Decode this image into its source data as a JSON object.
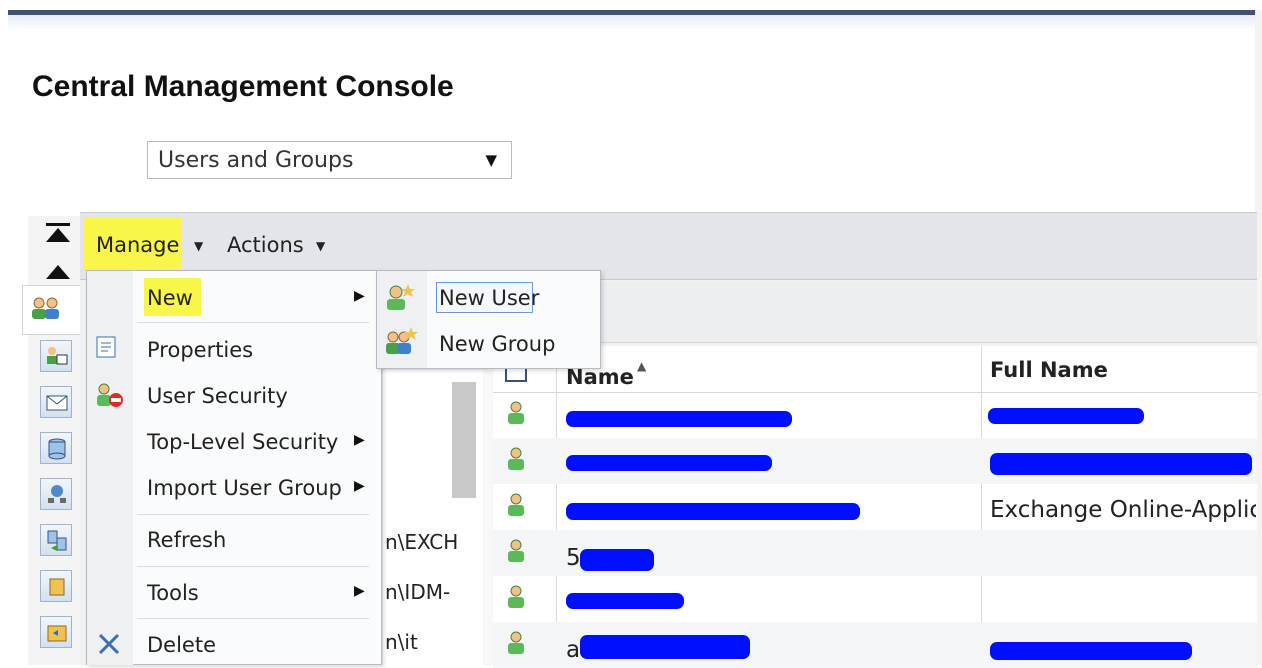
{
  "app": {
    "title": "Central Management Console"
  },
  "selector": {
    "value": "Users and Groups",
    "arrow": "▼"
  },
  "toolbar": {
    "manage": "Manage",
    "actions": "Actions"
  },
  "manage_menu": {
    "items": [
      {
        "label": "New",
        "icon": "",
        "submenu": true,
        "highlighted": true
      },
      {
        "label": "Properties",
        "icon": "properties-icon",
        "submenu": false
      },
      {
        "label": "User Security",
        "icon": "user-security-icon",
        "submenu": false
      },
      {
        "label": "Top-Level Security",
        "icon": "",
        "submenu": true
      },
      {
        "label": "Import User Group",
        "icon": "",
        "submenu": true
      },
      {
        "label": "Refresh",
        "icon": "",
        "submenu": false
      },
      {
        "label": "Tools",
        "icon": "",
        "submenu": true
      },
      {
        "label": "Delete",
        "icon": "delete-icon",
        "submenu": false
      }
    ]
  },
  "new_submenu": {
    "items": [
      {
        "label": "New User",
        "icon": "new-user-icon",
        "focused": true
      },
      {
        "label": "New Group",
        "icon": "new-group-icon"
      }
    ]
  },
  "tree_partial": [
    "n\\EXCH",
    "n\\IDM-",
    "n\\it"
  ],
  "table": {
    "columns": [
      {
        "label": "Name",
        "sort": "ascending"
      },
      {
        "label": "Full Name"
      }
    ],
    "rows": [
      {
        "name": "",
        "full_name": ""
      },
      {
        "name": "",
        "full_name": ""
      },
      {
        "name": "",
        "full_name": "Exchange Online-Applic"
      },
      {
        "name": "5",
        "full_name": ""
      },
      {
        "name": "",
        "full_name": ""
      },
      {
        "name": "a",
        "full_name": ""
      }
    ]
  },
  "colors": {
    "highlight": "#f9f64a",
    "redaction": "#0010ff",
    "header_bar": "#3a5278"
  }
}
